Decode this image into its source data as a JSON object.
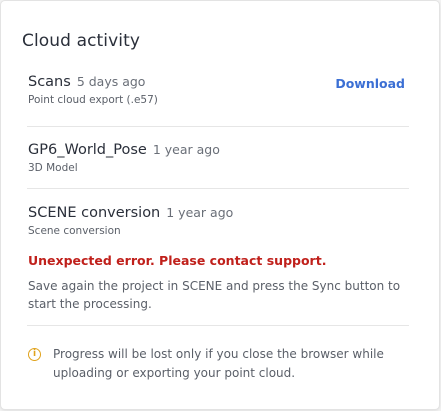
{
  "panel": {
    "title": "Cloud activity"
  },
  "items": [
    {
      "name": "Scans",
      "time": "5 days ago",
      "subtitle": "Point cloud export (.e57)",
      "action": "Download"
    },
    {
      "name": "GP6_World_Pose",
      "time": "1 year ago",
      "subtitle": "3D Model"
    },
    {
      "name": "SCENE conversion",
      "time": "1 year ago",
      "subtitle": "Scene conversion",
      "error_title": "Unexpected error. Please contact support.",
      "error_description": "Save again the project in SCENE and press the Sync button to start the processing."
    }
  ],
  "notice": {
    "icon": "info-icon",
    "text": "Progress will be lost only if you close the browser while uploading or exporting your point cloud."
  },
  "colors": {
    "accent": "#3b6fd4",
    "error": "#c0201b",
    "warning": "#e0a21c"
  }
}
